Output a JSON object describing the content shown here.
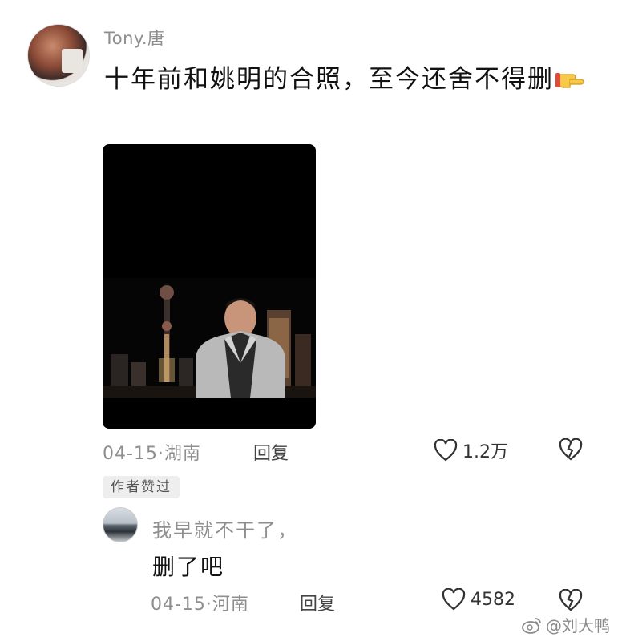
{
  "comment": {
    "username": "Tony.唐",
    "text": "十年前和姚明的合照，至今还舍不得删",
    "date_location": "04-15·湖南",
    "reply_label": "回复",
    "like_count": "1.2万",
    "author_liked_badge": "作者赞过"
  },
  "reply": {
    "username": "我早就不干了，",
    "text": "删了吧",
    "date_location": "04-15·河南",
    "reply_label": "回复",
    "like_count": "4582"
  },
  "watermark": {
    "text": "@刘大鸭"
  },
  "icons": {
    "pointing_hand": "pointing-right-emoji",
    "like": "heart-outline-icon",
    "dislike": "broken-heart-icon",
    "weibo": "weibo-logo-icon"
  }
}
